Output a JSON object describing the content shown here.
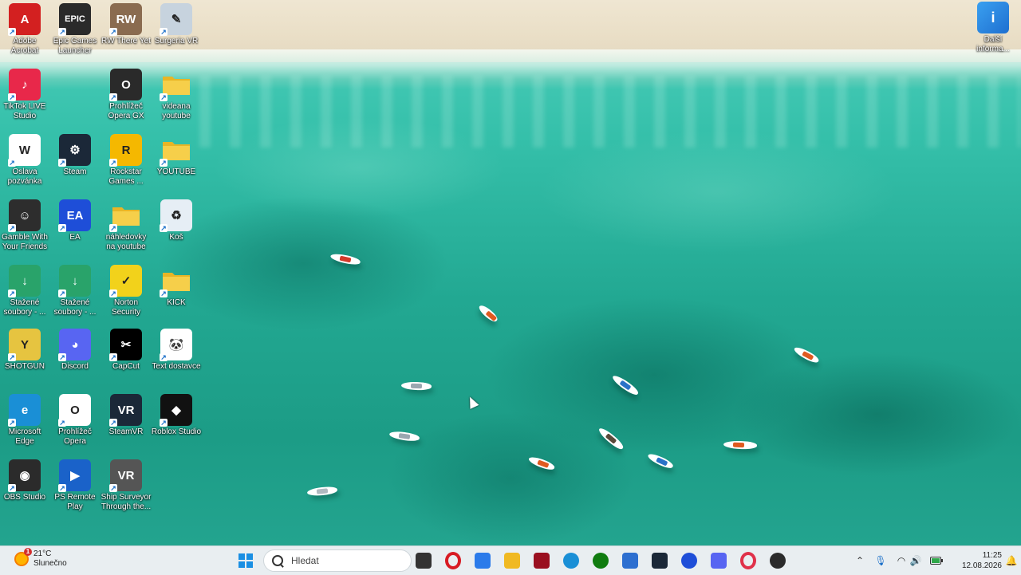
{
  "desktop": {
    "icons": [
      {
        "label": "Adobe Acrobat",
        "icon": "adobe-acrobat-icon",
        "color": "#d32020",
        "glyph": "A"
      },
      {
        "label": "Epic Games Launcher",
        "icon": "epic-games-icon",
        "color": "#2a2a2a",
        "glyph": "EPIC"
      },
      {
        "label": "RW There Yet",
        "icon": "rw-there-yet-icon",
        "color": "#8a6b50",
        "glyph": "RW"
      },
      {
        "label": "Surgeria VR",
        "icon": "surgeria-vr-icon",
        "color": "#c7d3de",
        "glyph": "✎"
      },
      {
        "label": "TikTok LIVE Studio",
        "icon": "tiktok-live-studio-icon",
        "color": "#e8284a",
        "glyph": "♪"
      },
      {
        "label": "Prohlížeč Opera GX",
        "icon": "opera-gx-icon",
        "color": "#2a2a2a",
        "glyph": "O"
      },
      {
        "label": "videana youtube",
        "icon": "folder-icon",
        "color": "#f0c33c",
        "glyph": ""
      },
      {
        "label": "Oslava pozvánka",
        "icon": "word-document-icon",
        "color": "#ffffff",
        "glyph": "W"
      },
      {
        "label": "Steam",
        "icon": "steam-icon",
        "color": "#1b2838",
        "glyph": "⚙"
      },
      {
        "label": "Rockstar Games ...",
        "icon": "rockstar-games-icon",
        "color": "#f5b800",
        "glyph": "R"
      },
      {
        "label": "YOUTUBE",
        "icon": "folder-icon",
        "color": "#f0c33c",
        "glyph": ""
      },
      {
        "label": "Gamble With Your Friends",
        "icon": "gamble-with-your-friends-icon",
        "color": "#2d2d2d",
        "glyph": "☺"
      },
      {
        "label": "EA",
        "icon": "ea-icon",
        "color": "#1e4ed8",
        "glyph": "EA"
      },
      {
        "label": "náhledovky na youtube",
        "icon": "folder-icon",
        "color": "#f0c33c",
        "glyph": ""
      },
      {
        "label": "Koš",
        "icon": "recycle-bin-icon",
        "color": "#e6eef5",
        "glyph": "♻"
      },
      {
        "label": "Stažené soubory - ...",
        "icon": "downloads-folder-icon",
        "color": "#29a36a",
        "glyph": "↓"
      },
      {
        "label": "Stažené soubory - ...",
        "icon": "downloads-folder-icon",
        "color": "#29a36a",
        "glyph": "↓"
      },
      {
        "label": "Norton Security",
        "icon": "norton-security-icon",
        "color": "#f2d21b",
        "glyph": "✓"
      },
      {
        "label": "KICK",
        "icon": "folder-icon",
        "color": "#f0c33c",
        "glyph": ""
      },
      {
        "label": "SHOTGUN",
        "icon": "shotgun-icon",
        "color": "#e6c440",
        "glyph": "Y"
      },
      {
        "label": "Discord",
        "icon": "discord-icon",
        "color": "#5865f2",
        "glyph": "◕"
      },
      {
        "label": "CapCut",
        "icon": "capcut-icon",
        "color": "#000000",
        "glyph": "✂"
      },
      {
        "label": "Text dostavce",
        "icon": "panda-image-icon",
        "color": "#ffffff",
        "glyph": "🐼"
      },
      {
        "label": "Microsoft Edge",
        "icon": "edge-icon",
        "color": "#1a8fd6",
        "glyph": "e"
      },
      {
        "label": "Prohlížeč Opera",
        "icon": "opera-icon",
        "color": "#ffffff",
        "glyph": "O"
      },
      {
        "label": "SteamVR",
        "icon": "steamvr-icon",
        "color": "#1b2838",
        "glyph": "VR"
      },
      {
        "label": "Roblox Studio",
        "icon": "roblox-studio-icon",
        "color": "#111111",
        "glyph": "◆"
      },
      {
        "label": "OBS Studio",
        "icon": "obs-studio-icon",
        "color": "#2b2b2b",
        "glyph": "◉"
      },
      {
        "label": "PS Remote Play",
        "icon": "ps-remote-play-icon",
        "color": "#1a62c9",
        "glyph": "▶"
      },
      {
        "label": "Ship Surveyor Through the...",
        "icon": "ship-surveyor-icon",
        "color": "#555555",
        "glyph": "VR"
      }
    ],
    "widget": {
      "label": "Další informa...",
      "icon": "info-picture-icon",
      "glyph": "i"
    }
  },
  "taskbar": {
    "weather": {
      "temp": "21°C",
      "condition": "Slunečno",
      "alert": "1"
    },
    "search_placeholder": "Hledat",
    "apps": [
      {
        "icon": "start-windows-icon",
        "color": "#1a8fe3"
      },
      {
        "icon": "task-view-icon",
        "color": "#333333"
      },
      {
        "icon": "opera-icon",
        "color": "#d81b23"
      },
      {
        "icon": "copilot-icon",
        "color": "#2b7bea"
      },
      {
        "icon": "file-explorer-icon",
        "color": "#f0b922"
      },
      {
        "icon": "app-red-icon",
        "color": "#9a1020"
      },
      {
        "icon": "edge-icon",
        "color": "#1a8fd6"
      },
      {
        "icon": "xbox-icon",
        "color": "#107c10"
      },
      {
        "icon": "microsoft-store-icon",
        "color": "#2d6fd0"
      },
      {
        "icon": "steam-icon",
        "color": "#1b2838"
      },
      {
        "icon": "ea-icon",
        "color": "#1e4ed8"
      },
      {
        "icon": "discord-icon",
        "color": "#5865f2"
      },
      {
        "icon": "opera-gx-icon",
        "color": "#e0314a"
      },
      {
        "icon": "obs-studio-icon",
        "color": "#2b2b2b"
      }
    ],
    "tray": {
      "time": "11:25",
      "date": "12.08.2026"
    }
  }
}
